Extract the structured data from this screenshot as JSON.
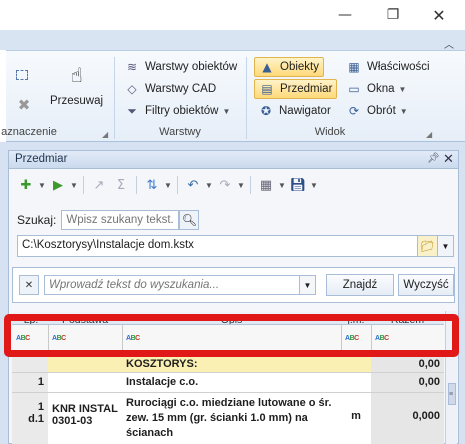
{
  "window": {
    "minimize_glyph": "—",
    "maximize_glyph": "❐",
    "close_glyph": "✕",
    "collapse_glyph": "︿"
  },
  "ribbon": {
    "groups": [
      {
        "label": "aznaczenie"
      },
      {
        "label": "Warstwy"
      },
      {
        "label": "Widok"
      }
    ],
    "buttons": {
      "select_rect": "",
      "move": "Przesuwaj",
      "object_layers": "Warstwy obiektów",
      "cad_layers": "Warstwy CAD",
      "object_filters": "Filtry obiektów",
      "objects": "Obiekty",
      "estimate": "Przedmiar",
      "navigator": "Nawigator",
      "properties": "Właściwości",
      "windows": "Okna",
      "rotation": "Obrót"
    }
  },
  "panel": {
    "title": "Przedmiar",
    "pin_glyph": "ᵖ",
    "close_glyph": "✕",
    "search": {
      "label": "Szukaj:",
      "placeholder": "Wpisz szukany tekst..."
    },
    "file_path": "C:\\Kosztorysy\\Instalacje dom.kstx",
    "filter": {
      "clear_glyph": "✕",
      "placeholder": "Wprowadź tekst do wyszukania...",
      "find_label": "Znajdź",
      "clear_label": "Wyczyść"
    },
    "grid": {
      "columns": [
        "Lp.",
        "Podstawa",
        "Opis",
        "j.m.",
        "Razem"
      ],
      "filter_tag": "ABC",
      "rows": [
        {
          "lp": "",
          "podstawa": "",
          "opis": "KOSZTORYS:",
          "jm": "",
          "razem": "0,00"
        },
        {
          "lp": "1",
          "podstawa": "",
          "opis": "Instalacje c.o.",
          "jm": "",
          "razem": "0,00"
        },
        {
          "lp": "1\nd.1",
          "podstawa": "KNR INSTAL 0301-03",
          "opis": "Rurociągi c.o. miedziane lutowane o śr. zew. 15 mm (gr. ścianki 1.0 mm) na ścianach",
          "jm": "m",
          "razem": "0,000"
        }
      ]
    }
  },
  "colors": {
    "highlight": "#e01818",
    "ribbon_active": "#ffd97a",
    "row_yellow": "#fbf0b3"
  }
}
